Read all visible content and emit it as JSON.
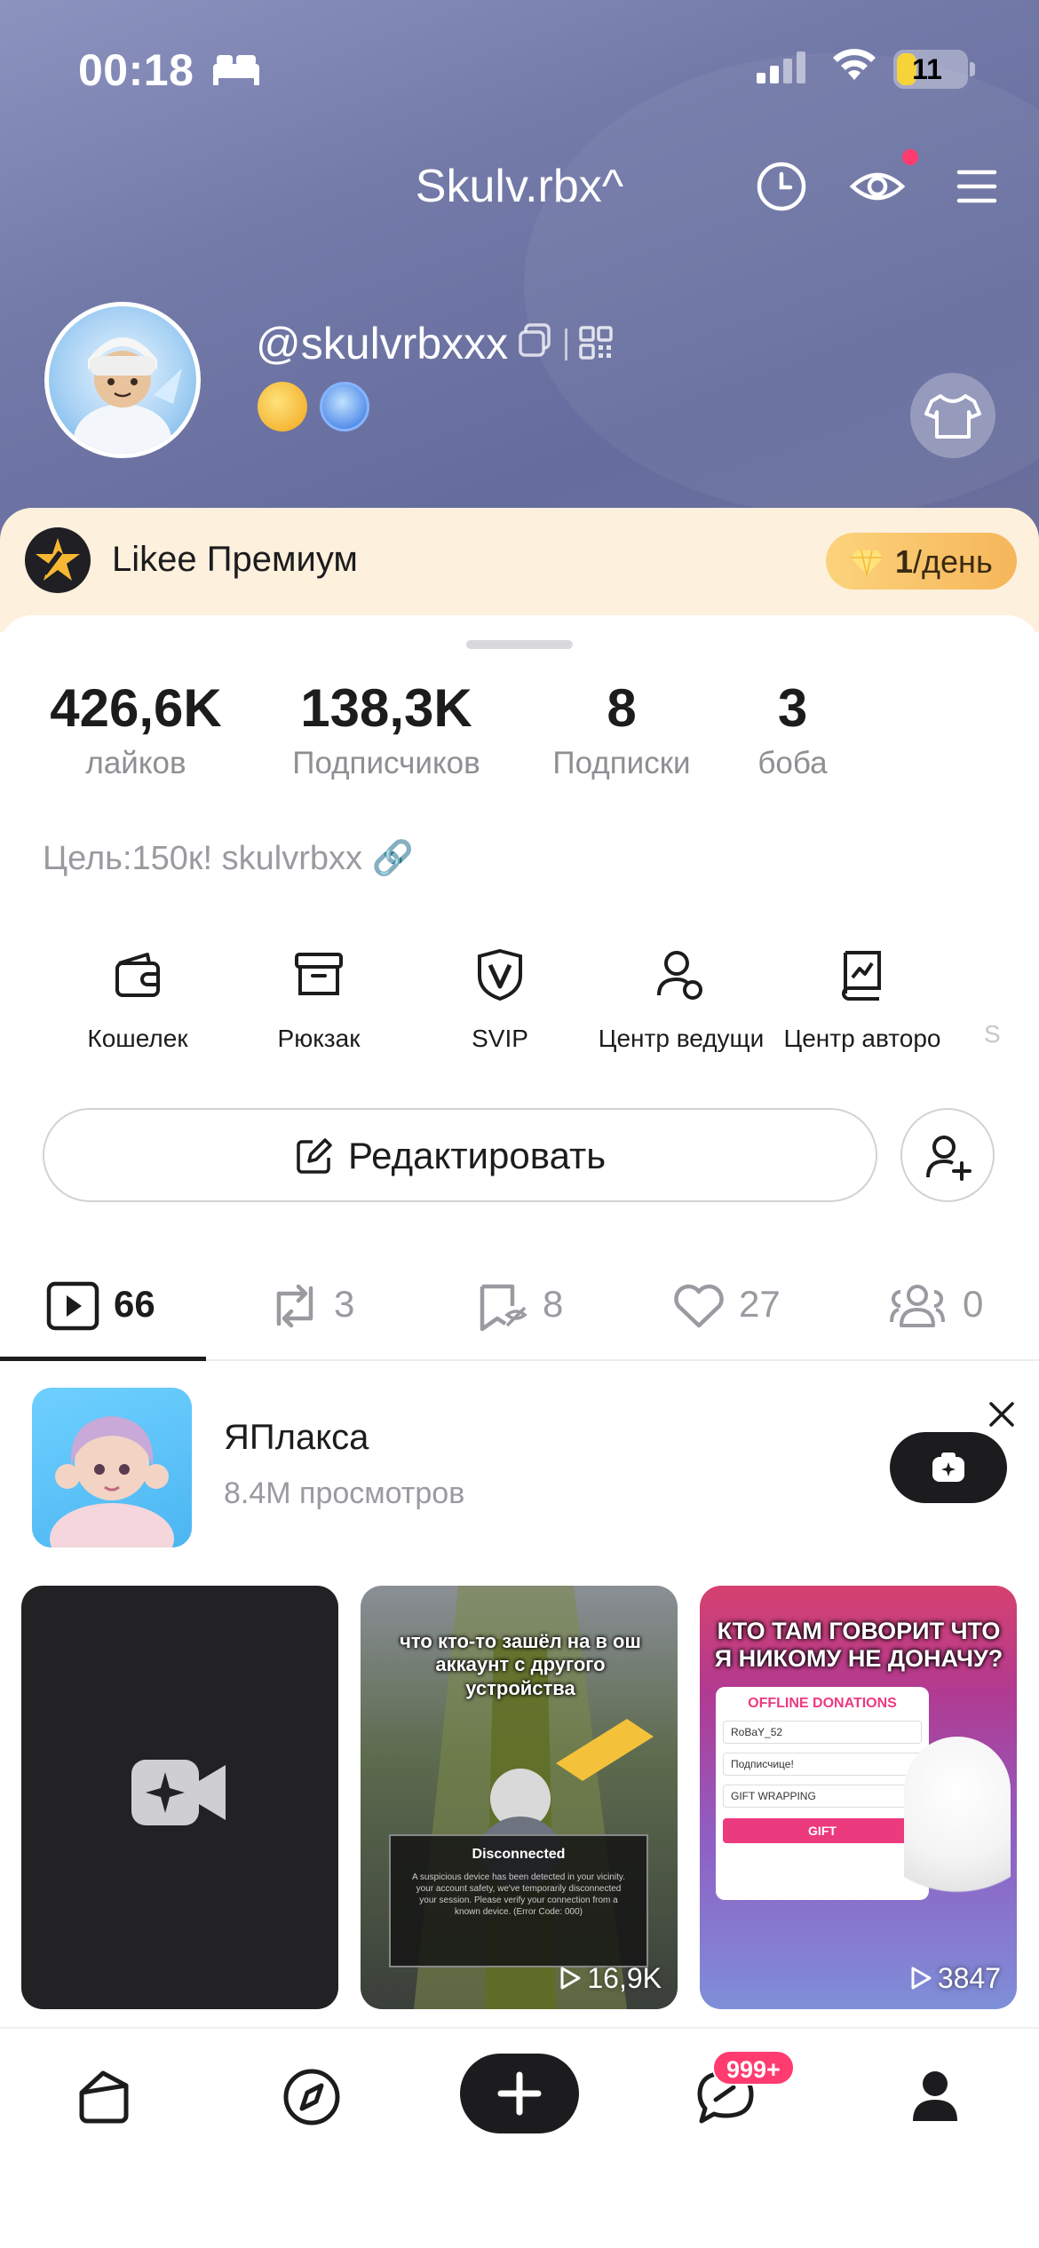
{
  "status_bar": {
    "time": "00:18",
    "battery": "11",
    "battery_level": 0.11
  },
  "header": {
    "title": "Skulv.rbx^"
  },
  "profile": {
    "username": "@skulvrbxxx"
  },
  "premium": {
    "label": "Likee Премиум",
    "price_amount": "1",
    "price_unit": "/день"
  },
  "stats": [
    {
      "value": "426,6K",
      "label": "лайков"
    },
    {
      "value": "138,3K",
      "label": "Подписчиков"
    },
    {
      "value": "8",
      "label": "Подписки"
    },
    {
      "value": "3",
      "label": "боба"
    }
  ],
  "bio": "Цель:150к! skulvrbxx 🔗",
  "tools": [
    {
      "label": "Кошелек",
      "icon": "wallet-icon"
    },
    {
      "label": "Рюкзак",
      "icon": "backpack-icon"
    },
    {
      "label": "SVIP",
      "icon": "svip-shield-icon"
    },
    {
      "label": "Центр ведущи",
      "icon": "host-center-icon"
    },
    {
      "label": "Центр авторо",
      "icon": "creator-center-icon"
    },
    {
      "label": "S",
      "icon": "more-icon"
    }
  ],
  "actions": {
    "edit_label": "Редактировать"
  },
  "tabs": [
    {
      "count": "66",
      "icon": "video-play-icon"
    },
    {
      "count": "3",
      "icon": "repost-icon"
    },
    {
      "count": "8",
      "icon": "bookmark-icon"
    },
    {
      "count": "27",
      "icon": "heart-icon"
    },
    {
      "count": "0",
      "icon": "group-icon"
    }
  ],
  "promo": {
    "title": "ЯПлакса",
    "subtitle": "8.4M просмотров"
  },
  "videos": [
    {
      "views": ""
    },
    {
      "views": "16,9K",
      "caption": "что кто-то зашёл на в ош аккаунт с другого устройства",
      "dialog_title": "Disconnected",
      "dialog_body": "A suspicious device has been detected in your vicinity. your account safety, we've temporarily disconnected your session. Please verify your connection from a known device. (Error Code: 000)"
    },
    {
      "views": "3847",
      "title": "КТО ТАМ ГОВОРИТ ЧТО Я НИКОМУ НЕ ДОНАЧУ?",
      "panel_title": "OFFLINE DONATIONS",
      "rows": [
        "RoBaY_52",
        "Подписчице!",
        "GIFT WRAPPING"
      ],
      "gift": "GIFT"
    }
  ],
  "bottom_nav": {
    "messages_badge": "999+"
  }
}
